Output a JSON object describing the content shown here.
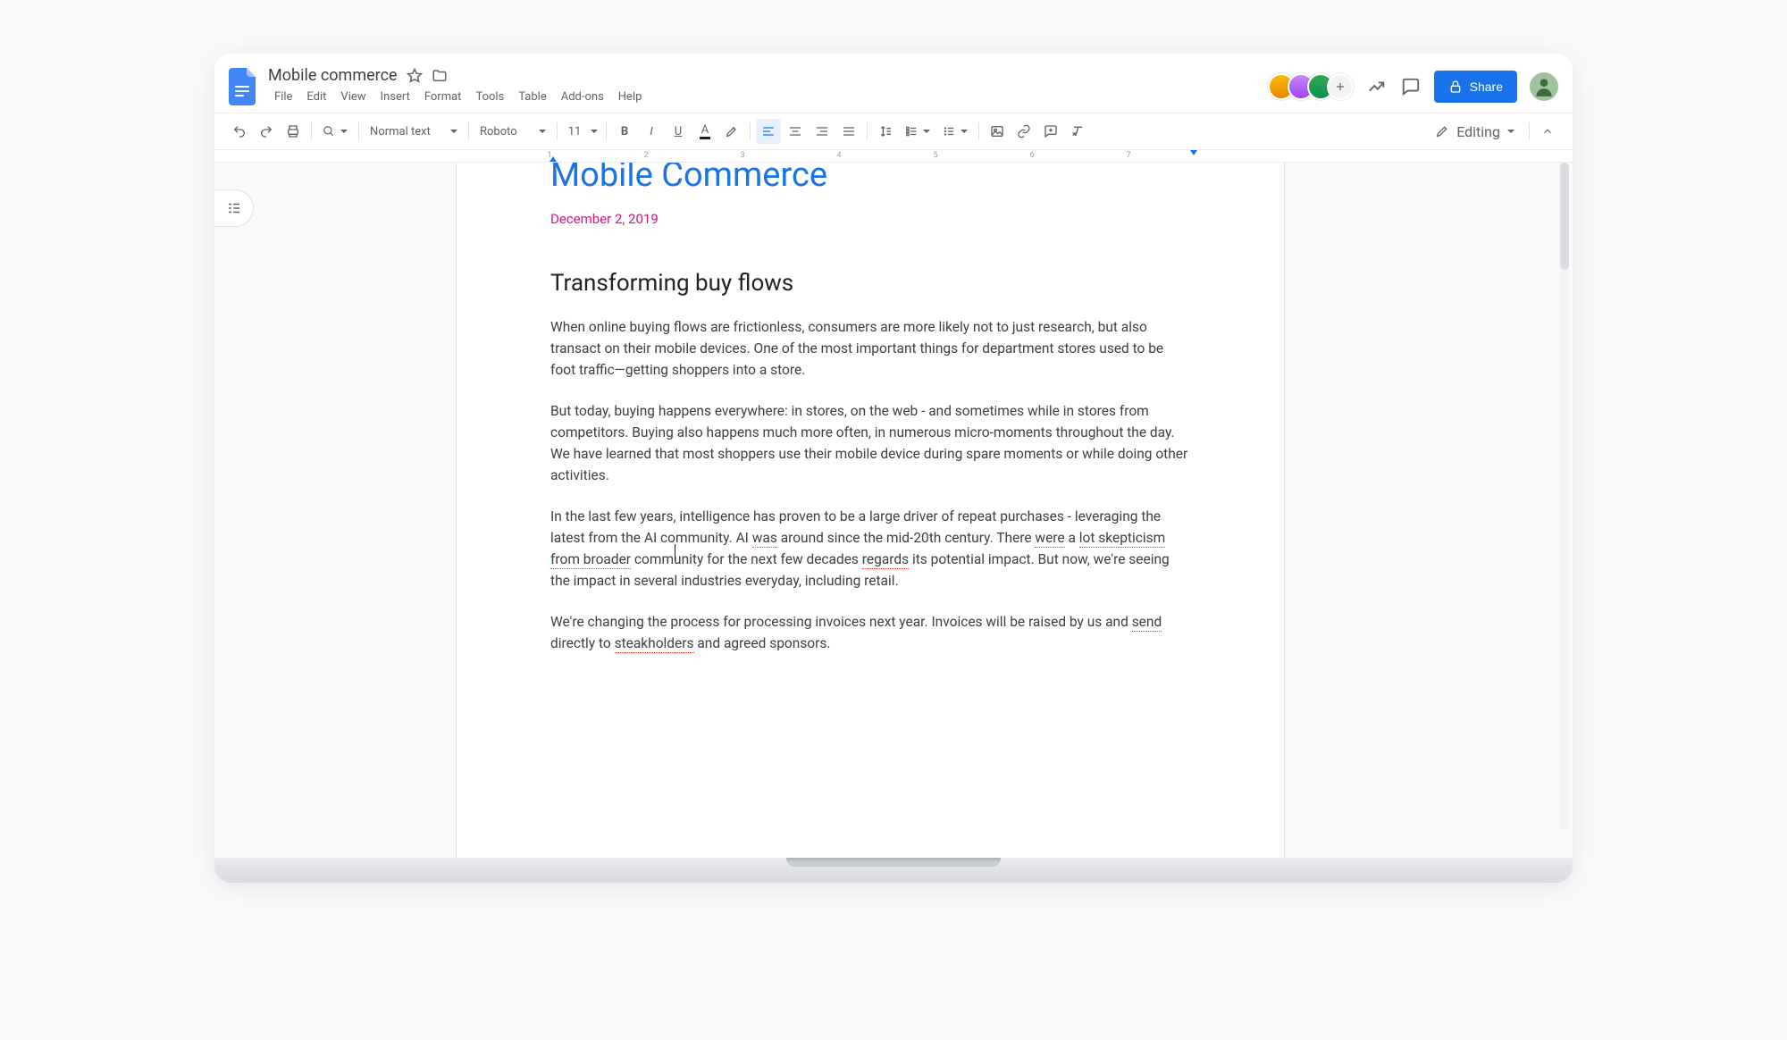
{
  "header": {
    "doc_title": "Mobile commerce",
    "menus": [
      "File",
      "Edit",
      "View",
      "Insert",
      "Format",
      "Tools",
      "Table",
      "Add-ons",
      "Help"
    ],
    "share_label": "Share",
    "avatars_more": "+"
  },
  "toolbar": {
    "style_label": "Normal text",
    "font_label": "Roboto",
    "font_size": "11",
    "mode_label": "Editing"
  },
  "ruler": {
    "ticks": [
      "1",
      "2",
      "3",
      "4",
      "5",
      "6",
      "7"
    ]
  },
  "document": {
    "title": "Mobile Commerce",
    "date": "December 2, 2019",
    "heading": "Transforming buy flows",
    "p1": "When online buying flows are frictionless, consumers are more likely not to  just research, but also transact on their mobile devices. One of the most important things for department stores used to be foot traffic—getting shoppers into a store.",
    "p2": "But today, buying happens everywhere: in stores, on the web - and sometimes while in stores from competitors. Buying also happens much more often, in numerous micro-moments throughout the day. We have learned that most shoppers use their mobile device during spare moments or while doing other activities.",
    "p3": {
      "a": "In the last few years, intelligence has proven to be a large driver of repeat purchases - leveraging the latest from the AI co",
      "b": "mmunity. AI ",
      "s1": "was",
      "c": " around since the mid-20th century. There ",
      "s2": "were",
      "d": " a ",
      "s3": "lot skepticism",
      "e": " ",
      "s4": "from broader",
      "f": " community for the next few decades ",
      "s5": "regards",
      "g": " its potential impact. But now, we're seeing the impact in several industries everyday, including retail."
    },
    "p4": {
      "a": "We're changing the process for processing invoices next year. Invoices will be raised by us and ",
      "s1": "send",
      "b": " directly to ",
      "s2": "steakholders",
      "c": " and agreed sponsors."
    }
  }
}
